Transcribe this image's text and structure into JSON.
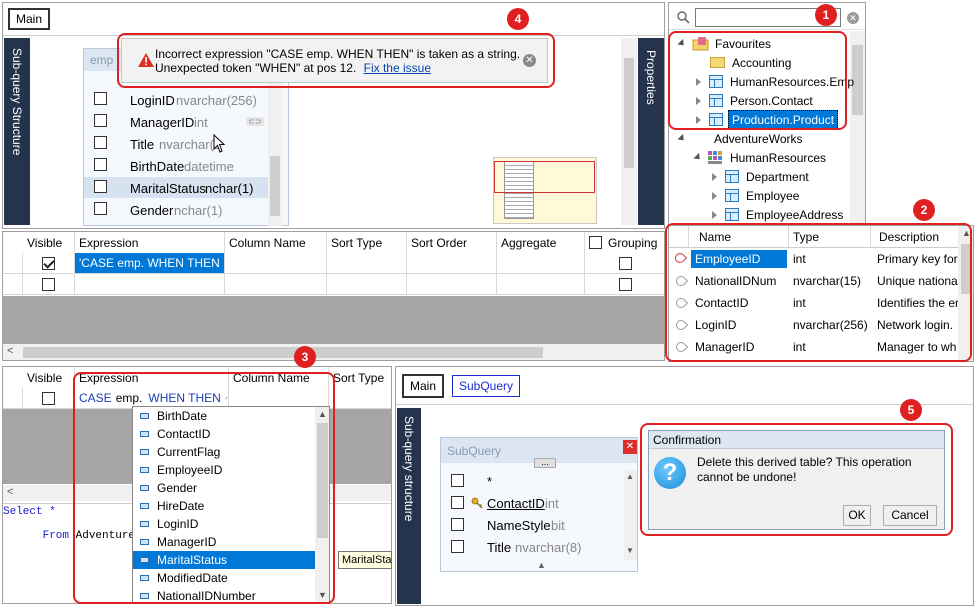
{
  "top_left": {
    "tab_main": "Main",
    "sub_query_structure": "Sub-query Structure",
    "properties": "Properties",
    "table_title": "emp",
    "fields": [
      {
        "name": "LoginID",
        "type": "nvarchar(256)"
      },
      {
        "name": "ManagerID",
        "type": "int"
      },
      {
        "name": "Title",
        "type": "nvarchar(5"
      },
      {
        "name": "BirthDate",
        "type": "datetime"
      },
      {
        "name": "MaritalStatus",
        "type": "nchar(1)"
      },
      {
        "name": "Gender",
        "type": "nchar(1)"
      }
    ],
    "error": {
      "line1": "Incorrect expression \"CASE emp.  WHEN THEN\" is taken as a string.",
      "line2": "Unexpected token \"WHEN\" at pos 12.",
      "link": "Fix the issue"
    }
  },
  "tree": {
    "search_placeholder": "",
    "items": [
      {
        "label": "Favourites"
      },
      {
        "label": "Accounting"
      },
      {
        "label": "HumanResources.Emp"
      },
      {
        "label": "Person.Contact"
      },
      {
        "label": "Production.Product"
      },
      {
        "label": "AdventureWorks"
      },
      {
        "label": "HumanResources"
      },
      {
        "label": "Department"
      },
      {
        "label": "Employee"
      },
      {
        "label": "EmployeeAddress"
      }
    ]
  },
  "grid1": {
    "headers": [
      "Visible",
      "Expression",
      "Column Name",
      "Sort Type",
      "Sort Order",
      "Aggregate",
      "Grouping"
    ],
    "row1_expression": "'CASE emp.  WHEN THEN ..."
  },
  "columns_panel": {
    "headers": [
      "Name",
      "Type",
      "Description"
    ],
    "rows": [
      {
        "name": "EmployeeID",
        "type": "int",
        "desc": "Primary key for I"
      },
      {
        "name": "NationalIDNum",
        "type": "nvarchar(15)",
        "desc": "Unique nationa"
      },
      {
        "name": "ContactID",
        "type": "int",
        "desc": "Identifies the er"
      },
      {
        "name": "LoginID",
        "type": "nvarchar(256)",
        "desc": "Network login."
      },
      {
        "name": "ManagerID",
        "type": "int",
        "desc": "Manager to wh"
      }
    ]
  },
  "grid2": {
    "headers": [
      "Visible",
      "Expression",
      "Column Name",
      "Sort Type"
    ],
    "expr_case": "CASE",
    "expr_emp": "emp.",
    "expr_when": "WHEN THEN",
    "tooltip": "MaritalStat",
    "sql_line1": "Select *",
    "sql_line2_kw": "From",
    "sql_line2_rest": " AdventureWorks",
    "autocomplete": [
      "BirthDate",
      "ContactID",
      "CurrentFlag",
      "EmployeeID",
      "Gender",
      "HireDate",
      "LoginID",
      "ManagerID",
      "MaritalStatus",
      "ModifiedDate",
      "NationalIDNumber"
    ]
  },
  "bottom_right": {
    "tab_main": "Main",
    "tab_subquery": "SubQuery",
    "sub_query_structure": "Sub-query structure",
    "subquery_title": "SubQuery",
    "ellipsis": "...",
    "fields": [
      {
        "name": "*",
        "type": ""
      },
      {
        "name": "ContactID",
        "type": "int"
      },
      {
        "name": "NameStyle",
        "type": "bit"
      },
      {
        "name": "Title",
        "type": "nvarchar(8)"
      }
    ],
    "dialog": {
      "title": "Confirmation",
      "line1": "Delete this derived table? This operation",
      "line2": "cannot be undone!",
      "ok": "OK",
      "cancel": "Cancel"
    }
  },
  "badges": [
    "1",
    "2",
    "3",
    "4",
    "5"
  ]
}
